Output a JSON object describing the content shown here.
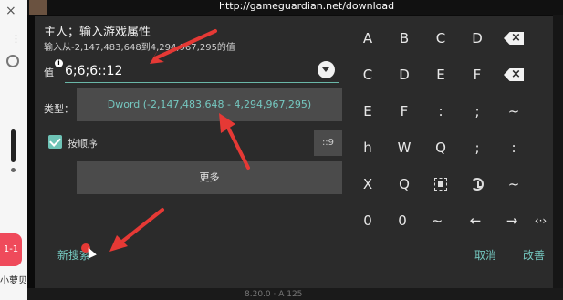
{
  "app": {
    "url": "http://gameguardian.net/download",
    "version_text": "8.20.0 · A 125",
    "sidebar_badge": "1-1",
    "sidebar_name": "小萝贝"
  },
  "dialog": {
    "title": "主人；输入游戏属性",
    "hint": "输入从-2,147,483,648到4,294,967,295的值",
    "value_label": "值",
    "value_info": "i",
    "value": "6;6;6::12",
    "type_label": "类型：",
    "type_value": "Dword (-2,147,483,648 - 4,294,967,295)",
    "ordered_label": "按顺序",
    "ordered_checked": true,
    "range_button": "::9",
    "more_button": "更多",
    "new_search_button": "新搜索"
  },
  "keyboard": {
    "rows": [
      [
        "A",
        "B",
        "C",
        "D",
        "backspace-icon"
      ],
      [
        "C",
        "D",
        "E",
        "F",
        "delete-icon"
      ],
      [
        "E",
        "F",
        ":",
        ";",
        "~"
      ],
      [
        "h",
        "W",
        "Q",
        ";",
        ":"
      ],
      [
        "X",
        "Q",
        "select-all-icon",
        "history-icon",
        "~"
      ],
      [
        "0",
        "0",
        "~",
        "←",
        "→",
        "‹·›"
      ]
    ],
    "cancel_button": "取消",
    "edit_button": "改善"
  },
  "colors": {
    "accent": "#75c8c0",
    "dialog_bg": "#2b2b2b",
    "button_bg": "#4b4b4b",
    "annotation": "#e53935",
    "badge": "#ef4a5b"
  }
}
